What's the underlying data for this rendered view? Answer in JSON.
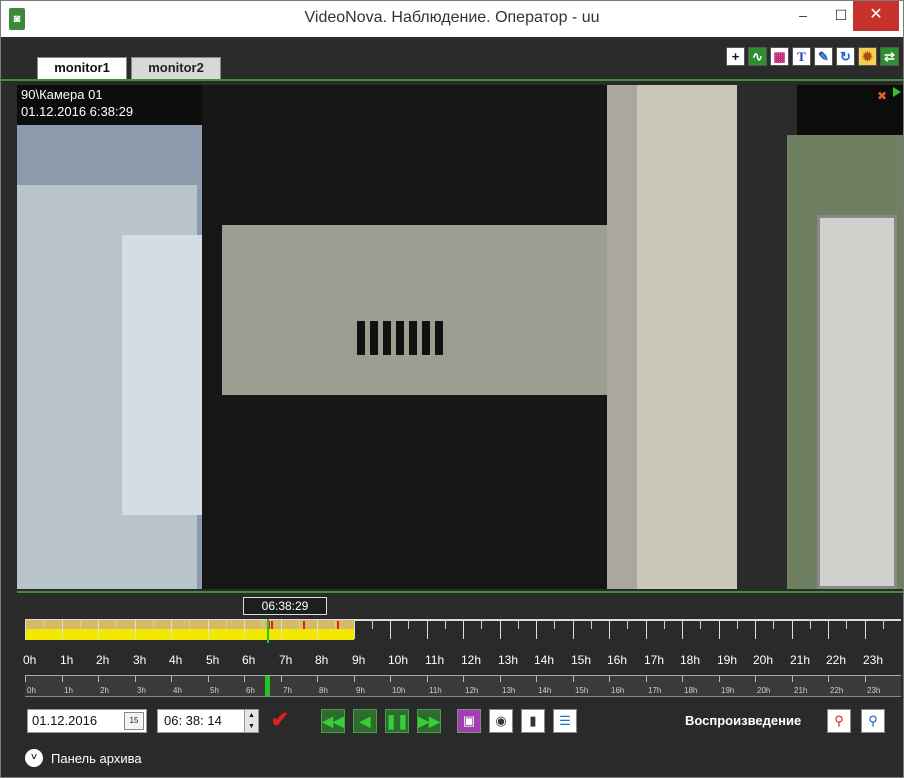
{
  "window": {
    "title": "VideoNova. Наблюдение. Оператор - uu",
    "controls": {
      "minimize": "–",
      "maximize": "☐",
      "close": "✕"
    }
  },
  "tabs": [
    {
      "label": "monitor1",
      "active": true
    },
    {
      "label": "monitor2",
      "active": false
    }
  ],
  "toolbar": {
    "icons": [
      "add-icon",
      "activity-icon",
      "layout-icon",
      "text-icon",
      "edit-icon",
      "refresh-icon",
      "settings-icon",
      "switch-icon"
    ]
  },
  "video": {
    "camera_name": "90\\Камера 01",
    "timestamp": "01.12.2016 6:38:29"
  },
  "timeline": {
    "cursor_time": "06:38:29",
    "hours": [
      "0h",
      "1h",
      "2h",
      "3h",
      "4h",
      "5h",
      "6h",
      "7h",
      "8h",
      "9h",
      "10h",
      "11h",
      "12h",
      "13h",
      "14h",
      "15h",
      "16h",
      "17h",
      "18h",
      "19h",
      "20h",
      "21h",
      "22h",
      "23h"
    ],
    "recorded_until_hour": 9,
    "cursor_hour": 6.64
  },
  "controls": {
    "date": "01.12.2016",
    "calendar_day": "15",
    "time": "06: 38: 14",
    "mode_label": "Воспроизведение"
  },
  "archive_panel": {
    "label": "Панель архива"
  },
  "colors": {
    "accent_green": "#3e8e3e",
    "recording_yellow": "#f2e800",
    "close_red": "#c7332c"
  }
}
